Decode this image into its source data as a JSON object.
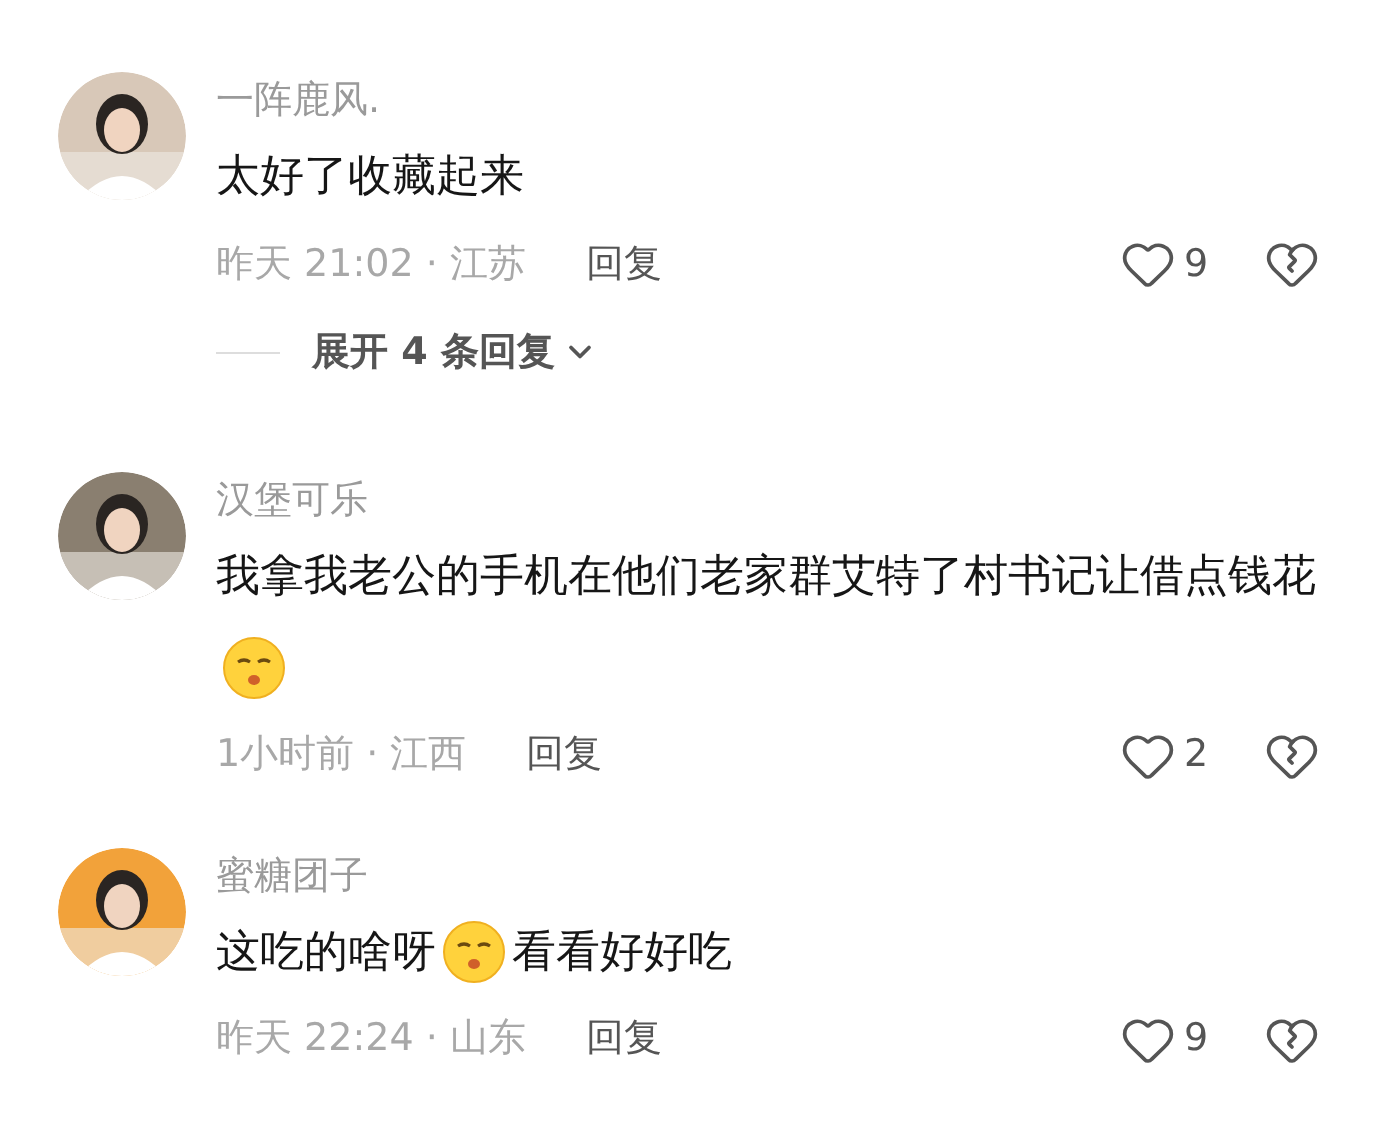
{
  "comments": [
    {
      "username": "一阵鹿风.",
      "content": [
        {
          "kind": "text",
          "text": "太好了收藏起来"
        }
      ],
      "meta": "昨天 21:02 · 江苏",
      "reply": "回复",
      "likes": "9",
      "expand": "展开 4 条回复"
    },
    {
      "username": "汉堡可乐",
      "content": [
        {
          "kind": "text",
          "text": "我拿我老公的手机在他们老家群艾特了村书记让借点钱花"
        },
        {
          "kind": "emoji"
        }
      ],
      "meta": "1小时前 · 江西",
      "reply": "回复",
      "likes": "2"
    },
    {
      "username": "蜜糖团子",
      "content": [
        {
          "kind": "text",
          "text": "这吃的啥呀"
        },
        {
          "kind": "emoji"
        },
        {
          "kind": "text",
          "text": "看看好好吃"
        }
      ],
      "meta": "昨天 22:24 · 山东",
      "reply": "回复",
      "likes": "9"
    }
  ]
}
